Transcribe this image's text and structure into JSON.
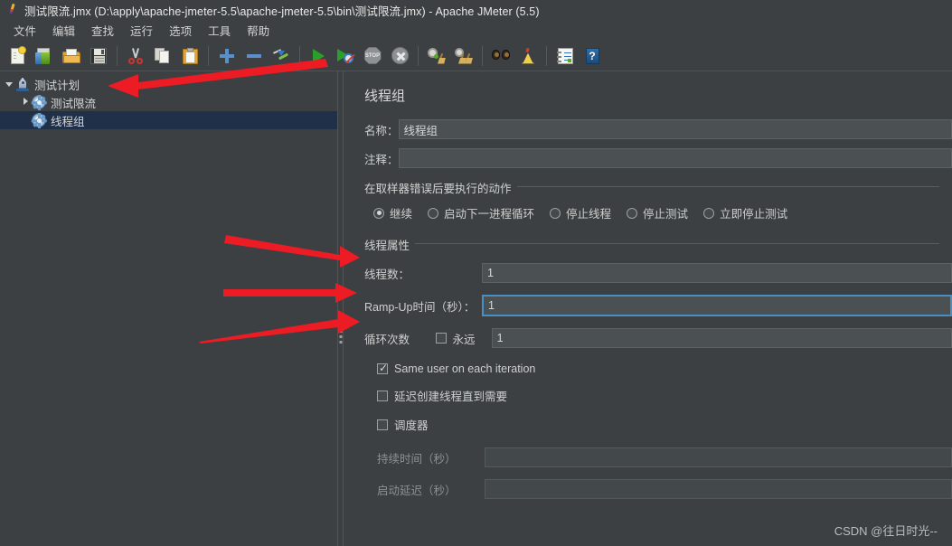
{
  "window": {
    "title": "测试限流.jmx (D:\\apply\\apache-jmeter-5.5\\apache-jmeter-5.5\\bin\\测试限流.jmx) - Apache JMeter (5.5)",
    "app_icon": "jmeter-feather-icon"
  },
  "menu": {
    "items": [
      {
        "label": "文件"
      },
      {
        "label": "编辑"
      },
      {
        "label": "查找"
      },
      {
        "label": "运行"
      },
      {
        "label": "选项"
      },
      {
        "label": "工具"
      },
      {
        "label": "帮助"
      }
    ]
  },
  "toolbar": {
    "buttons": [
      {
        "name": "new-button",
        "icon": "new-document-icon"
      },
      {
        "name": "templates-button",
        "icon": "templates-icon"
      },
      {
        "name": "open-button",
        "icon": "open-folder-icon"
      },
      {
        "name": "save-button",
        "icon": "save-disk-icon"
      },
      {
        "name": "cut-button",
        "icon": "scissors-icon"
      },
      {
        "name": "copy-button",
        "icon": "copy-icon"
      },
      {
        "name": "paste-button",
        "icon": "paste-icon"
      },
      {
        "name": "expand-all-button",
        "icon": "plus-icon"
      },
      {
        "name": "collapse-all-button",
        "icon": "minus-icon"
      },
      {
        "name": "toggle-button",
        "icon": "toggle-icon"
      },
      {
        "name": "start-button",
        "icon": "play-green-icon"
      },
      {
        "name": "start-no-pauses-button",
        "icon": "play-no-pauses-icon"
      },
      {
        "name": "stop-button",
        "icon": "stop-sign-icon"
      },
      {
        "name": "shutdown-button",
        "icon": "shutdown-icon"
      },
      {
        "name": "clear-button",
        "icon": "gear-broom-icon"
      },
      {
        "name": "clear-all-button",
        "icon": "gear-broom-all-icon"
      },
      {
        "name": "search-button",
        "icon": "binoculars-icon"
      },
      {
        "name": "reset-search-button",
        "icon": "bell-broom-icon"
      },
      {
        "name": "function-helper-button",
        "icon": "notepad-icon"
      },
      {
        "name": "help-button",
        "icon": "help-book-icon"
      }
    ]
  },
  "tree": {
    "nodes": [
      {
        "label": "测试计划",
        "icon": "test-plan-icon",
        "expander": "down",
        "indent": 0,
        "selected": false
      },
      {
        "label": "测试限流",
        "icon": "thread-group-icon",
        "expander": "right",
        "indent": 1,
        "selected": false
      },
      {
        "label": "线程组",
        "icon": "thread-group-icon",
        "expander": "none",
        "indent": 1,
        "selected": true
      }
    ]
  },
  "form": {
    "title": "线程组",
    "name_label": "名称：",
    "name_value": "线程组",
    "comment_label": "注释：",
    "comment_value": "",
    "error_action": {
      "group_title": "在取样器错误后要执行的动作",
      "options": [
        {
          "label": "继续",
          "selected": true
        },
        {
          "label": "启动下一进程循环",
          "selected": false
        },
        {
          "label": "停止线程",
          "selected": false
        },
        {
          "label": "停止测试",
          "selected": false
        },
        {
          "label": "立即停止测试",
          "selected": false
        }
      ]
    },
    "thread_properties": {
      "group_title": "线程属性",
      "num_threads_label": "线程数：",
      "num_threads_value": "1",
      "ramp_up_label": "Ramp-Up时间（秒）：",
      "ramp_up_value": "1",
      "ramp_up_focused": true,
      "loop_count_label": "循环次数",
      "forever_label": "永远",
      "forever_checked": false,
      "loop_count_value": "1",
      "same_user_label": "Same user on each iteration",
      "same_user_checked": true,
      "delayed_start_label": "延迟创建线程直到需要",
      "delayed_start_checked": false,
      "scheduler_label": "调度器",
      "scheduler_checked": false,
      "duration_label": "持续时间（秒）",
      "duration_value": "",
      "duration_disabled": true,
      "startup_delay_label": "启动延迟（秒）",
      "startup_delay_value": "",
      "startup_delay_disabled": true
    }
  },
  "annotations": {
    "arrow_color": "#ed1c24",
    "arrows": [
      {
        "name": "arrow-to-test-plan",
        "direction": "left"
      },
      {
        "name": "arrow-to-num-threads",
        "direction": "right"
      },
      {
        "name": "arrow-to-ramp-up",
        "direction": "right"
      },
      {
        "name": "arrow-to-loop-count",
        "direction": "right"
      }
    ]
  },
  "watermark": {
    "text": "CSDN @往日时光--"
  },
  "colors": {
    "window_bg": "#3c4042",
    "input_bg": "#4b5053",
    "selection_bg": "#1f3048",
    "focus_border": "#4a8fc4",
    "accent_red": "#ed1c24"
  }
}
